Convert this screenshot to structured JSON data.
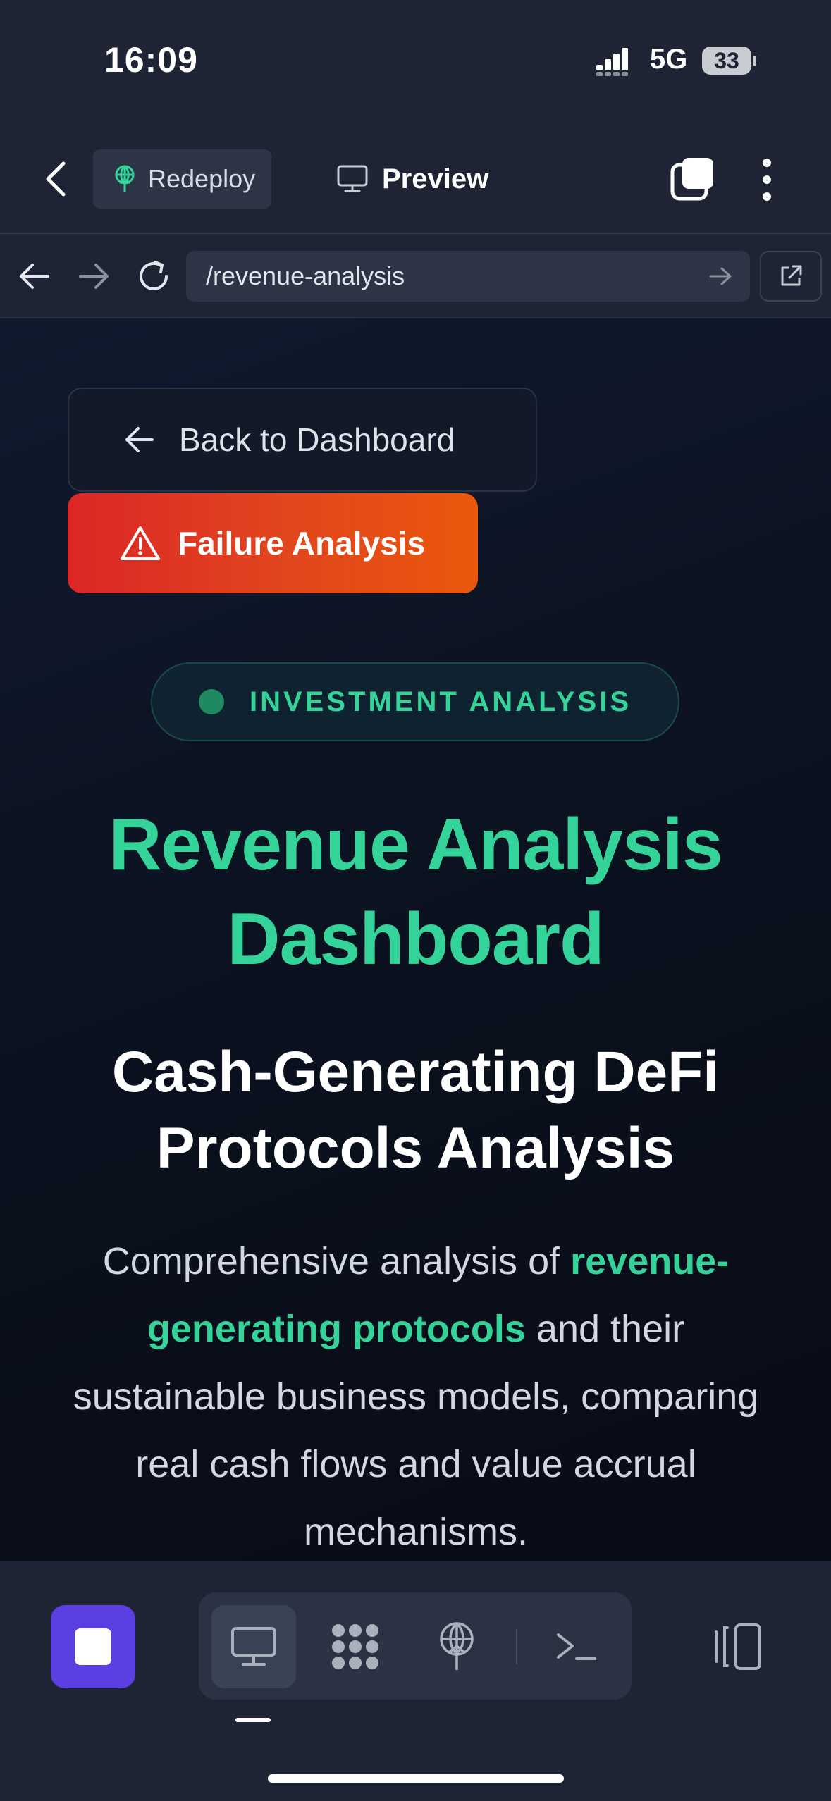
{
  "status_bar": {
    "time": "16:09",
    "network": "5G",
    "battery": "33"
  },
  "header": {
    "redeploy_label": "Redeploy",
    "preview_label": "Preview"
  },
  "url_bar": {
    "path": "/revenue-analysis"
  },
  "page": {
    "back_button": "Back to Dashboard",
    "failure_button": "Failure Analysis",
    "badge": "INVESTMENT ANALYSIS",
    "title_line1": "Revenue Analysis",
    "title_line2": "Dashboard",
    "subtitle_line1": "Cash-Generating DeFi",
    "subtitle_line2": "Protocols Analysis",
    "desc_before": "Comprehensive analysis of ",
    "desc_highlight": "revenue-generating protocols",
    "desc_after": " and their sustainable business models, comparing real cash flows and value accrual mechanisms."
  },
  "colors": {
    "accent_green": "#34d399",
    "failure_gradient_start": "#dc2626",
    "failure_gradient_end": "#ea580c",
    "stop_button": "#5b3fe0"
  },
  "bottom_bar": {
    "icons": [
      "stop-icon",
      "monitor-icon",
      "modules-icon",
      "deploy-icon",
      "terminal-icon",
      "layout-icon"
    ]
  }
}
